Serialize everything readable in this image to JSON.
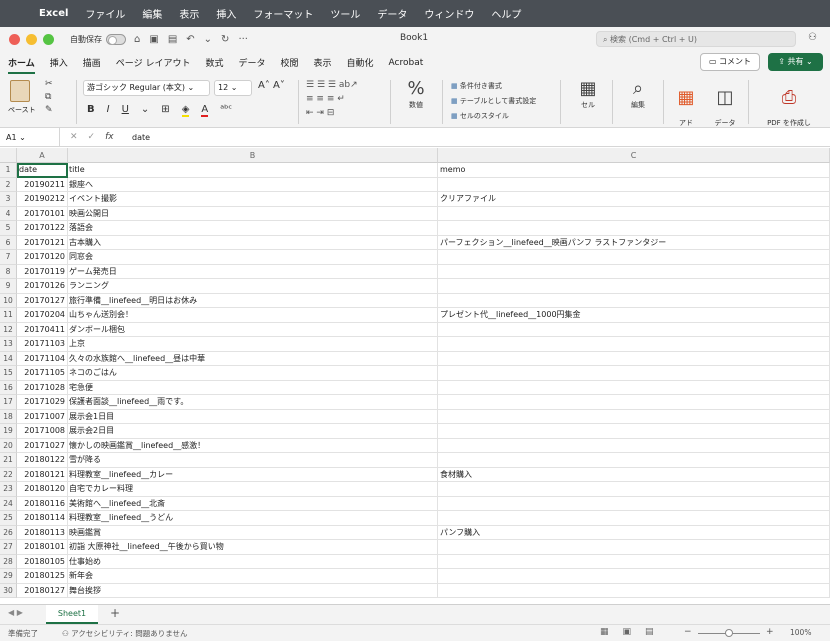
{
  "menubar": {
    "app": "Excel",
    "items": [
      "ファイル",
      "編集",
      "表示",
      "挿入",
      "フォーマット",
      "ツール",
      "データ",
      "ウィンドウ",
      "ヘルプ"
    ]
  },
  "titlebar": {
    "autosave": "自動保存",
    "book_title": "Book1",
    "search_placeholder": "検索 (Cmd + Ctrl + U)"
  },
  "tabs": [
    "ホーム",
    "挿入",
    "描画",
    "ページ レイアウト",
    "数式",
    "データ",
    "校閲",
    "表示",
    "自動化",
    "Acrobat"
  ],
  "buttons": {
    "comment": "コメント",
    "share": "共有"
  },
  "ribbon": {
    "paste": "ペースト",
    "font_name": "游ゴシック Regular (本文)",
    "font_size": "12",
    "number_label": "数値",
    "cond_format": "条件付き書式",
    "table_format": "テーブルとして書式設定",
    "cell_style": "セルのスタイル",
    "cells_label": "セル",
    "edit_label": "編集",
    "addin_label": "アド\nイン",
    "analyze_label": "データ\nの分析",
    "pdf_label": "PDF を作成し\nてリンクを共有"
  },
  "formula_bar": {
    "name_box": "A1",
    "fx": "fx",
    "value": "date"
  },
  "columns": [
    "A",
    "B",
    "C"
  ],
  "rows": [
    {
      "n": "1",
      "a": "date",
      "b": "title",
      "c": "memo"
    },
    {
      "n": "2",
      "a": "20190211",
      "b": "銀座へ",
      "c": ""
    },
    {
      "n": "3",
      "a": "20190212",
      "b": "イベント撮影",
      "c": "クリアファイル"
    },
    {
      "n": "4",
      "a": "20170101",
      "b": "映画公開日",
      "c": ""
    },
    {
      "n": "5",
      "a": "20170122",
      "b": "落語会",
      "c": ""
    },
    {
      "n": "6",
      "a": "20170121",
      "b": "古本購入",
      "c": "パーフェクション__linefeed__映画パンフ ラストファンタジー"
    },
    {
      "n": "7",
      "a": "20170120",
      "b": "同窓会",
      "c": ""
    },
    {
      "n": "8",
      "a": "20170119",
      "b": "ゲーム発売日",
      "c": ""
    },
    {
      "n": "9",
      "a": "20170126",
      "b": "ランニング",
      "c": ""
    },
    {
      "n": "10",
      "a": "20170127",
      "b": "旅行準備__linefeed__明日はお休み",
      "c": ""
    },
    {
      "n": "11",
      "a": "20170204",
      "b": "山ちゃん送別会！",
      "c": "プレゼント代__linefeed__1000円集金"
    },
    {
      "n": "12",
      "a": "20170411",
      "b": "ダンボール梱包",
      "c": ""
    },
    {
      "n": "13",
      "a": "20171103",
      "b": "上京",
      "c": ""
    },
    {
      "n": "14",
      "a": "20171104",
      "b": "久々の水族館へ__linefeed__昼は中華",
      "c": ""
    },
    {
      "n": "15",
      "a": "20171105",
      "b": "ネコのごはん",
      "c": ""
    },
    {
      "n": "16",
      "a": "20171028",
      "b": "宅急便",
      "c": ""
    },
    {
      "n": "17",
      "a": "20171029",
      "b": "保護者面談__linefeed__雨です。",
      "c": ""
    },
    {
      "n": "18",
      "a": "20171007",
      "b": "展示会1日目",
      "c": ""
    },
    {
      "n": "19",
      "a": "20171008",
      "b": "展示会2日目",
      "c": ""
    },
    {
      "n": "20",
      "a": "20171027",
      "b": "懐かしの映画鑑賞__linefeed__感激！",
      "c": ""
    },
    {
      "n": "21",
      "a": "20180122",
      "b": "雪が降る",
      "c": ""
    },
    {
      "n": "22",
      "a": "20180121",
      "b": "料理教室__linefeed__カレー",
      "c": "食材購入"
    },
    {
      "n": "23",
      "a": "20180120",
      "b": "自宅でカレー料理",
      "c": ""
    },
    {
      "n": "24",
      "a": "20180116",
      "b": "美術館へ__linefeed__北斎",
      "c": ""
    },
    {
      "n": "25",
      "a": "20180114",
      "b": "料理教室__linefeed__うどん",
      "c": ""
    },
    {
      "n": "26",
      "a": "20180113",
      "b": "映画鑑賞",
      "c": "パンフ購入"
    },
    {
      "n": "27",
      "a": "20180101",
      "b": "初詣 大原神社__linefeed__午後から買い物",
      "c": ""
    },
    {
      "n": "28",
      "a": "20180105",
      "b": "仕事始め",
      "c": ""
    },
    {
      "n": "29",
      "a": "20180125",
      "b": "新年会",
      "c": ""
    },
    {
      "n": "30",
      "a": "20180127",
      "b": "舞台挨拶",
      "c": ""
    }
  ],
  "sheet": {
    "tab_name": "Sheet1",
    "add": "+"
  },
  "status": {
    "ready": "準備完了",
    "accessibility": "アクセシビリティ: 問題ありません",
    "zoom": "100%",
    "zoom_minus": "−",
    "zoom_plus": "+"
  },
  "colors": {
    "accent": "#1e7145",
    "menubar": "#4a4f55"
  }
}
